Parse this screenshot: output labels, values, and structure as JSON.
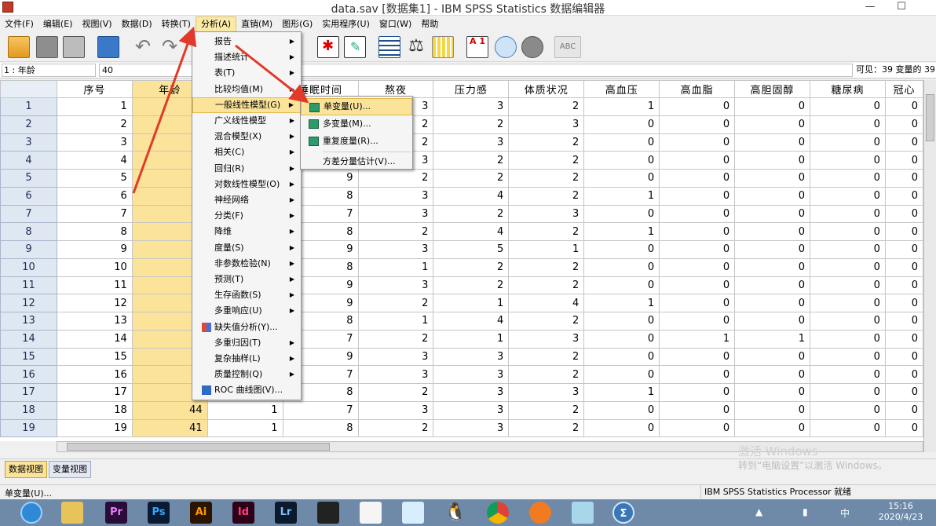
{
  "window": {
    "title": "data.sav [数据集1] - IBM SPSS Statistics 数据编辑器",
    "min_glyph": "—",
    "max_glyph": "☐"
  },
  "menubar": [
    "文件(F)",
    "编辑(E)",
    "视图(V)",
    "数据(D)",
    "转换(T)",
    "分析(A)",
    "直销(M)",
    "图形(G)",
    "实用程序(U)",
    "窗口(W)",
    "帮助"
  ],
  "active_menu": "分析(A)",
  "toolbar_icons": [
    "open-icon",
    "save-icon",
    "print-icon",
    "import-icon",
    "undo-icon",
    "redo-icon",
    "find-icon",
    "edit-icon",
    "table-icon",
    "scale-icon",
    "grid-icon",
    "sort-icon",
    "circles-icon",
    "spheres-icon",
    "spellcheck-icon"
  ],
  "toolbar_text": {
    "undo": "↶",
    "redo": "↷",
    "sort": "A 1",
    "spell": "ABC",
    "scale": "⚖"
  },
  "cell_editor": {
    "cell_name": "1 : 年龄",
    "cell_value": "40",
    "visible_info": "可见：39 变量的 39"
  },
  "grid": {
    "columns": [
      "序号",
      "年龄",
      "",
      "睡眠时间",
      "熬夜",
      "压力感",
      "体质状况",
      "高血压",
      "高血脂",
      "高胆固醇",
      "糖尿病",
      "冠心"
    ],
    "rows": [
      [
        "1",
        "1",
        "",
        "",
        "",
        "3",
        "3",
        "2",
        "1",
        "0",
        "0",
        "0",
        "0"
      ],
      [
        "2",
        "2",
        "",
        "",
        "",
        "2",
        "2",
        "3",
        "0",
        "0",
        "0",
        "0",
        "0"
      ],
      [
        "3",
        "3",
        "",
        "",
        "",
        "2",
        "3",
        "2",
        "0",
        "0",
        "0",
        "0",
        "0"
      ],
      [
        "4",
        "4",
        "",
        "",
        "",
        "3",
        "2",
        "2",
        "0",
        "0",
        "0",
        "0",
        "0"
      ],
      [
        "5",
        "5",
        "",
        "",
        "9",
        "2",
        "2",
        "2",
        "0",
        "0",
        "0",
        "0",
        "0"
      ],
      [
        "6",
        "6",
        "",
        "",
        "8",
        "3",
        "4",
        "2",
        "1",
        "0",
        "0",
        "0",
        "0"
      ],
      [
        "7",
        "7",
        "",
        "",
        "7",
        "3",
        "2",
        "3",
        "0",
        "0",
        "0",
        "0",
        "0"
      ],
      [
        "8",
        "8",
        "",
        "",
        "8",
        "2",
        "4",
        "2",
        "1",
        "0",
        "0",
        "0",
        "0"
      ],
      [
        "9",
        "9",
        "",
        "",
        "9",
        "3",
        "5",
        "1",
        "0",
        "0",
        "0",
        "0",
        "0"
      ],
      [
        "10",
        "10",
        "",
        "",
        "8",
        "1",
        "2",
        "2",
        "0",
        "0",
        "0",
        "0",
        "0"
      ],
      [
        "11",
        "11",
        "",
        "",
        "9",
        "3",
        "2",
        "2",
        "0",
        "0",
        "0",
        "0",
        "0"
      ],
      [
        "12",
        "12",
        "",
        "",
        "9",
        "2",
        "1",
        "4",
        "1",
        "0",
        "0",
        "0",
        "0"
      ],
      [
        "13",
        "13",
        "",
        "",
        "8",
        "1",
        "4",
        "2",
        "0",
        "0",
        "0",
        "0",
        "0"
      ],
      [
        "14",
        "14",
        "",
        "",
        "7",
        "2",
        "1",
        "3",
        "0",
        "1",
        "1",
        "0",
        "0"
      ],
      [
        "15",
        "15",
        "",
        "",
        "9",
        "3",
        "3",
        "2",
        "0",
        "0",
        "0",
        "0",
        "0"
      ],
      [
        "16",
        "16",
        "",
        "",
        "7",
        "3",
        "3",
        "2",
        "0",
        "0",
        "0",
        "0",
        "0"
      ],
      [
        "17",
        "17",
        "",
        "",
        "8",
        "2",
        "3",
        "3",
        "1",
        "0",
        "0",
        "0",
        "0"
      ],
      [
        "18",
        "18",
        "44",
        "1",
        "7",
        "3",
        "3",
        "2",
        "0",
        "0",
        "0",
        "0",
        "0"
      ],
      [
        "19",
        "19",
        "41",
        "1",
        "8",
        "2",
        "3",
        "2",
        "0",
        "0",
        "0",
        "0",
        "0"
      ]
    ]
  },
  "analyze_menu": [
    {
      "label": "报告",
      "sub": true,
      "icon": ""
    },
    {
      "label": "描述统计",
      "sub": true,
      "icon": ""
    },
    {
      "label": "表(T)",
      "sub": true,
      "icon": ""
    },
    {
      "label": "比较均值(M)",
      "sub": true,
      "icon": ""
    },
    {
      "label": "一般线性模型(G)",
      "sub": true,
      "icon": "",
      "highlight": true
    },
    {
      "label": "广义线性模型",
      "sub": true,
      "icon": ""
    },
    {
      "label": "混合模型(X)",
      "sub": true,
      "icon": ""
    },
    {
      "label": "相关(C)",
      "sub": true,
      "icon": ""
    },
    {
      "label": "回归(R)",
      "sub": true,
      "icon": ""
    },
    {
      "label": "对数线性模型(O)",
      "sub": true,
      "icon": ""
    },
    {
      "label": "神经网络",
      "sub": true,
      "icon": ""
    },
    {
      "label": "分类(F)",
      "sub": true,
      "icon": ""
    },
    {
      "label": "降维",
      "sub": true,
      "icon": ""
    },
    {
      "label": "度量(S)",
      "sub": true,
      "icon": ""
    },
    {
      "label": "非参数检验(N)",
      "sub": true,
      "icon": ""
    },
    {
      "label": "预测(T)",
      "sub": true,
      "icon": ""
    },
    {
      "label": "生存函数(S)",
      "sub": true,
      "icon": ""
    },
    {
      "label": "多重响应(U)",
      "sub": true,
      "icon": ""
    },
    {
      "label": "缺失值分析(Y)...",
      "sub": false,
      "icon": "missing-value-icon"
    },
    {
      "label": "多重归因(T)",
      "sub": true,
      "icon": ""
    },
    {
      "label": "复杂抽样(L)",
      "sub": true,
      "icon": ""
    },
    {
      "label": "质量控制(Q)",
      "sub": true,
      "icon": ""
    },
    {
      "label": "ROC 曲线图(V)...",
      "sub": false,
      "icon": "roc-curve-icon"
    }
  ],
  "glm_submenu": [
    {
      "label": "单变量(U)...",
      "icon": "univariate-icon",
      "highlight": true
    },
    {
      "label": "多变量(M)...",
      "icon": "multivariate-icon"
    },
    {
      "label": "重复度量(R)...",
      "icon": "repeated-measures-icon"
    },
    {
      "label": "方差分量估计(V)...",
      "icon": ""
    }
  ],
  "tabs": {
    "data_view": "数据视图",
    "variable_view": "变量视图"
  },
  "watermark": {
    "line1": "激活 Windows",
    "line2": "转到“电脑设置”以激活 Windows。"
  },
  "statusbar": {
    "left": "单变量(U)...",
    "right": "IBM SPSS Statistics Processor 就绪"
  },
  "taskbar": {
    "apps": [
      {
        "name": "start-icon",
        "text": ""
      },
      {
        "name": "file-explorer-icon",
        "text": ""
      },
      {
        "name": "premiere-icon",
        "text": "Pr"
      },
      {
        "name": "photoshop-icon",
        "text": "Ps"
      },
      {
        "name": "illustrator-icon",
        "text": "Ai"
      },
      {
        "name": "indesign-icon",
        "text": "Id"
      },
      {
        "name": "lightroom-icon",
        "text": "Lr"
      },
      {
        "name": "film-icon",
        "text": ""
      },
      {
        "name": "app-icon",
        "text": ""
      },
      {
        "name": "app-icon",
        "text": ""
      },
      {
        "name": "qq-icon",
        "text": "🐧"
      },
      {
        "name": "chrome-icon",
        "text": ""
      },
      {
        "name": "app-icon",
        "text": ""
      },
      {
        "name": "app-icon",
        "text": ""
      },
      {
        "name": "spss-icon",
        "text": "Σ"
      }
    ],
    "ime": "中",
    "time": "15:16",
    "date": "2020/4/23"
  }
}
